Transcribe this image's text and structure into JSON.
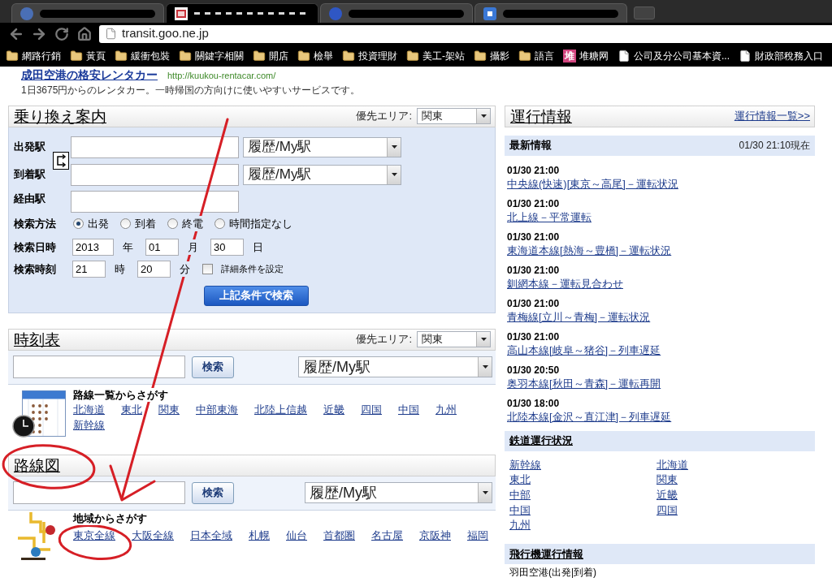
{
  "browser": {
    "tabs": [
      {
        "selected": false
      },
      {
        "selected": true
      },
      {
        "selected": false
      },
      {
        "selected": false
      }
    ],
    "address": "transit.goo.ne.jp",
    "bookmarks": [
      {
        "kind": "folder",
        "label": "網路行銷"
      },
      {
        "kind": "folder",
        "label": "黃頁"
      },
      {
        "kind": "folder",
        "label": "緩衝包裝"
      },
      {
        "kind": "folder",
        "label": "關鍵字相關"
      },
      {
        "kind": "folder",
        "label": "開店"
      },
      {
        "kind": "folder",
        "label": "檢舉"
      },
      {
        "kind": "folder",
        "label": "投資理財"
      },
      {
        "kind": "folder",
        "label": "美工-架站"
      },
      {
        "kind": "folder",
        "label": "攝影"
      },
      {
        "kind": "folder",
        "label": "語言"
      },
      {
        "kind": "site",
        "badge": "堆",
        "label": "堆糖网"
      },
      {
        "kind": "page",
        "label": "公司及分公司基本資..."
      },
      {
        "kind": "page",
        "label": "財政部稅務入口"
      }
    ]
  },
  "ad": {
    "title": "成田空港の格安レンタカー",
    "url": "http://kuukou-rentacar.com/",
    "description": "1日3675円からのレンタカー。一時帰国の方向けに使いやすいサービスです。"
  },
  "transfer": {
    "title": "乗り換え案内",
    "area_label": "優先エリア:",
    "area": "関東",
    "stations": [
      {
        "label": "出発駅",
        "history": "履歴/My駅"
      },
      {
        "label": "到着駅",
        "history": "履歴/My駅"
      },
      {
        "label": "経由駅"
      }
    ],
    "method": {
      "label": "検索方法",
      "options": [
        {
          "label": "出発",
          "selected": true
        },
        {
          "label": "到着",
          "selected": false
        },
        {
          "label": "終電",
          "selected": false
        },
        {
          "label": "時間指定なし",
          "selected": false
        }
      ]
    },
    "date": {
      "label": "検索日時",
      "parts": [
        {
          "value": "2013",
          "unit": "年"
        },
        {
          "value": "01",
          "unit": "月"
        },
        {
          "value": "30",
          "unit": "日"
        }
      ]
    },
    "time": {
      "label": "検索時刻",
      "parts": [
        {
          "value": "21",
          "unit": "時"
        },
        {
          "value": "20",
          "unit": "分"
        }
      ],
      "detail": {
        "label": "詳細条件を設定",
        "checked": false
      }
    },
    "submit": "上記条件で検索"
  },
  "timetable": {
    "title": "時刻表",
    "area_label": "優先エリア:",
    "area": "関東",
    "search_button": "検索",
    "history": "履歴/My駅",
    "list_title": "路線一覧からさがす",
    "links": [
      "北海道",
      "東北",
      "関東",
      "中部東海",
      "北陸上信越",
      "近畿",
      "四国",
      "中国",
      "九州",
      "新幹線"
    ]
  },
  "route_map": {
    "title": "路線図",
    "search_button": "検索",
    "history": "履歴/My駅",
    "list_title": "地域からさがす",
    "links": [
      "東京全線",
      "大阪全線",
      "日本全域",
      "札幌",
      "仙台",
      "首都圏",
      "名古屋",
      "京阪神",
      "福岡"
    ]
  },
  "operation": {
    "title": "運行情報",
    "all_link": "運行情報一覧>>",
    "latest": {
      "title": "最新情報",
      "as_of": "01/30 21:10現在"
    },
    "items": [
      {
        "time": "01/30 21:00",
        "text": "中央線(快速)[東京～高尾]－運転状況"
      },
      {
        "time": "01/30 21:00",
        "text": "北上線－平常運転"
      },
      {
        "time": "01/30 21:00",
        "text": "東海道本線[熱海～豊橋]－運転状況"
      },
      {
        "time": "01/30 21:00",
        "text": "釧網本線－運転見合わせ"
      },
      {
        "time": "01/30 21:00",
        "text": "青梅線[立川～青梅]－運転状況"
      },
      {
        "time": "01/30 21:00",
        "text": "高山本線[岐阜～猪谷]－列車遅延"
      },
      {
        "time": "01/30 20:50",
        "text": "奥羽本線[秋田～青森]－運転再開"
      },
      {
        "time": "01/30 18:00",
        "text": "北陸本線[金沢～直江津]－列車遅延"
      }
    ],
    "rail": {
      "title": "鉄道運行状況",
      "links": [
        "新幹線",
        "北海道",
        "東北",
        "関東",
        "中部",
        "近畿",
        "中国",
        "四国",
        "九州"
      ]
    },
    "air": {
      "title": "飛行機運行情報",
      "items": [
        "羽田空港(出発|到着)"
      ]
    }
  }
}
